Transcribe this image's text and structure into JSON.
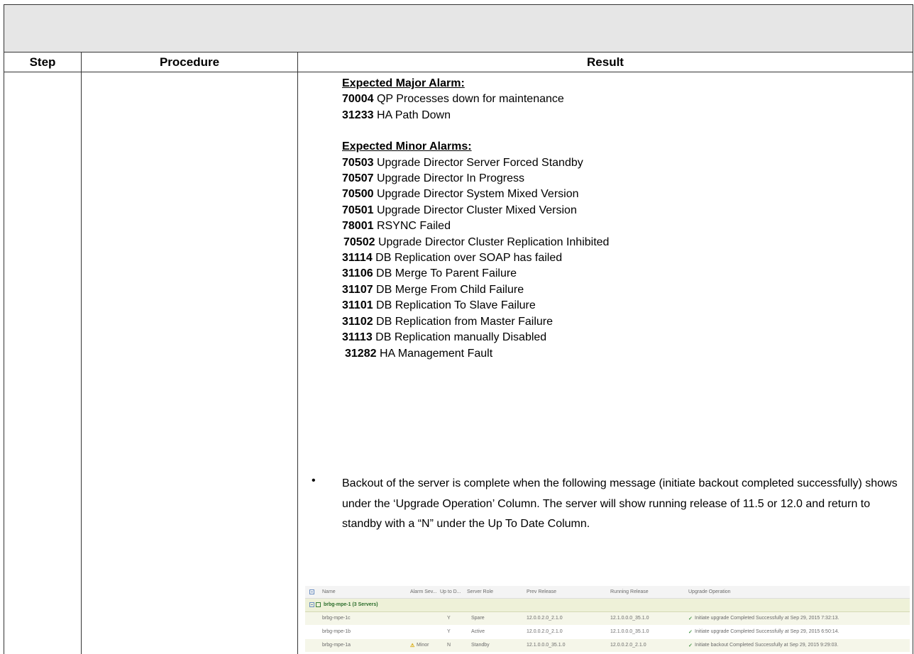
{
  "table": {
    "headers": {
      "step": "Step",
      "procedure": "Procedure",
      "result": "Result"
    }
  },
  "result": {
    "major_title": "Expected Major Alarm:",
    "major": [
      {
        "code": "70004",
        "text": " QP Processes down for maintenance"
      },
      {
        "code": "31233",
        "text": " HA Path Down"
      }
    ],
    "minor_title": "Expected Minor Alarms:",
    "minor": [
      {
        "code": "70503",
        "text": " Upgrade Director Server Forced Standby"
      },
      {
        "code": "70507",
        "text": " Upgrade Director In Progress"
      },
      {
        "code": "70500",
        "text": " Upgrade Director System Mixed Version"
      },
      {
        "code": "70501",
        "text": " Upgrade Director Cluster Mixed Version"
      },
      {
        "code": "78001",
        "text": " RSYNC Failed"
      },
      {
        "code": "70502",
        "text": " Upgrade Director Cluster Replication Inhibited"
      },
      {
        "code": "31114",
        "text": " DB Replication over SOAP has failed"
      },
      {
        "code": "31106",
        "text": " DB Merge To Parent Failure"
      },
      {
        "code": "31107",
        "text": " DB Merge From Child Failure"
      },
      {
        "code": "31101",
        "text": " DB Replication To Slave Failure"
      },
      {
        "code": "31102",
        "text": " DB Replication from Master Failure"
      },
      {
        "code": "31113",
        "text": " DB Replication manually Disabled"
      },
      {
        "code": "31282",
        "text": " HA Management Fault"
      }
    ],
    "bullet_symbol": "•",
    "bullet_text": "Backout of the server is complete when the following message (initiate backout completed successfully) shows under the ‘Upgrade Operation’ Column. The server will show running release of 11.5 or 12.0 and return to standby with a “N” under the Up To Date Column."
  },
  "screenshot": {
    "columns": [
      "Name",
      "Alarm Sev...",
      "Up to D...",
      "Server Role",
      "Prev Release",
      "Running Release",
      "Upgrade Operation"
    ],
    "group": "brbg-mpe-1 (3 Servers)",
    "rows": [
      {
        "name": "brbg-mpe-1c",
        "alarm": "",
        "uptodate": "Y",
        "role": "Spare",
        "prev": "12.0.0.2.0_2.1.0",
        "running": "12.1.0.0.0_35.1.0",
        "op": "Initiate upgrade Completed Successfully at Sep 29, 2015 7:32:13."
      },
      {
        "name": "brbg-mpe-1b",
        "alarm": "",
        "uptodate": "Y",
        "role": "Active",
        "prev": "12.0.0.2.0_2.1.0",
        "running": "12.1.0.0.0_35.1.0",
        "op": "Initiate upgrade Completed Successfully at Sep 29, 2015 6:50:14."
      },
      {
        "name": "brbg-mpe-1a",
        "alarm": "Minor",
        "uptodate": "N",
        "role": "Standby",
        "prev": "12.1.0.0.0_35.1.0",
        "running": "12.0.0.2.0_2.1.0",
        "op": "Initiate backout Completed Successfully at Sep 29, 2015 9:29:03."
      }
    ],
    "icons": {
      "check": "check-icon",
      "warning": "warning-icon",
      "collapse": "collapse-icon"
    }
  }
}
